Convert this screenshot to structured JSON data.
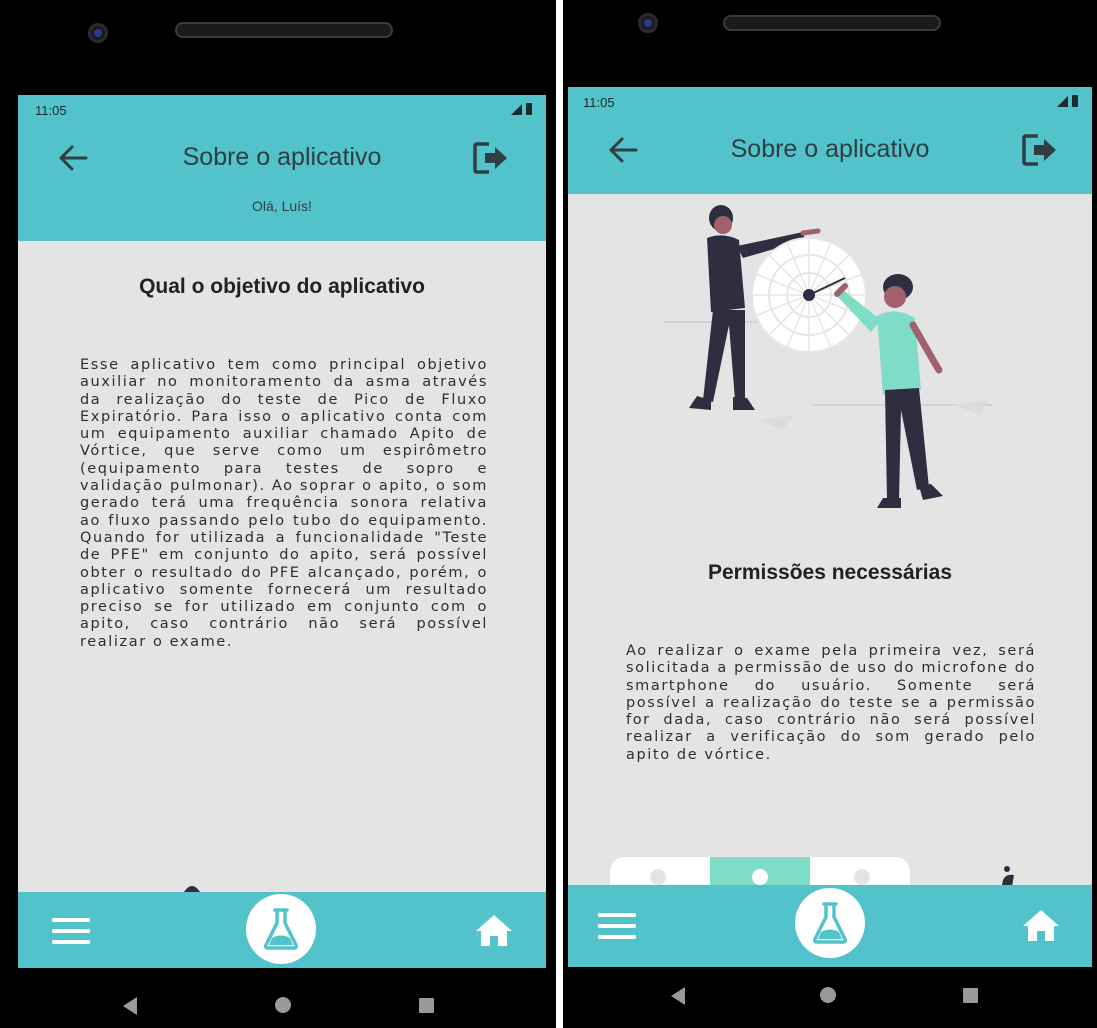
{
  "left": {
    "status_time": "11:05",
    "title": "Sobre o aplicativo",
    "greeting": "Olá, Luís!",
    "section_title": "Qual o objetivo do aplicativo",
    "body": "Esse aplicativo tem como principal objetivo auxiliar no monitoramento da asma através da realização do teste de Pico de Fluxo Expiratório. Para isso o aplicativo conta com um equipamento auxiliar chamado Apito de Vórtice, que serve como um espirômetro (equipamento para testes de sopro e validação pulmonar). Ao soprar o apito, o som gerado terá uma frequência sonora relativa ao fluxo passando pelo tubo do equipamento. Quando for utilizada a funcionalidade \"Teste de PFE\" em conjunto do apito, será possível obter o resultado do PFE alcançado, porém, o aplicativo somente fornecerá um resultado preciso se for utilizado em conjunto com o apito, caso contrário não será possível realizar o exame."
  },
  "right": {
    "status_time": "11:05",
    "title": "Sobre o aplicativo",
    "section_title": "Permissões necessárias",
    "body": "Ao realizar o exame pela primeira vez, será solicitada a permissão de uso do microfone do smartphone do usuário. Somente será possível a realização do teste se a permissão for dada, caso contrário não será possível realizar a verificação do som gerado pelo apito de vórtice."
  },
  "icons": {
    "back": "arrow-left-icon",
    "logout": "logout-icon",
    "menu": "menu-icon",
    "flask": "flask-icon",
    "home": "home-icon",
    "illustration": "people-dartboard-illustration"
  },
  "colors": {
    "accent": "#52c2cb",
    "screen_bg": "#e4e4e4",
    "text": "#2e2e2e",
    "illustration_mint": "#7fdcc7",
    "illustration_dark": "#2f2e41"
  }
}
